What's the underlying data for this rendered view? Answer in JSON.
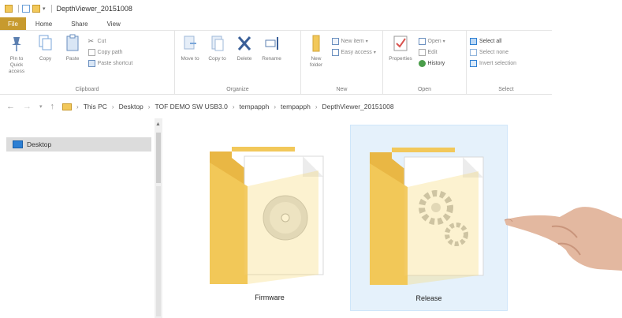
{
  "window": {
    "title": "DepthViewer_20151008"
  },
  "tabs": [
    {
      "label": "File"
    },
    {
      "label": "Home"
    },
    {
      "label": "Share"
    },
    {
      "label": "View"
    }
  ],
  "ribbon": {
    "clipboard": {
      "pin_label": "Pin to Quick access",
      "copy_label": "Copy",
      "paste_label": "Paste",
      "cut_label": "Cut",
      "copy_path_label": "Copy path",
      "paste_shortcut_label": "Paste shortcut",
      "group_label": "Clipboard"
    },
    "organize": {
      "move_to_label": "Move to",
      "copy_to_label": "Copy to",
      "delete_label": "Delete",
      "rename_label": "Rename",
      "group_label": "Organize"
    },
    "new": {
      "new_folder_label": "New folder",
      "new_item_label": "New item",
      "easy_access_label": "Easy access",
      "group_label": "New"
    },
    "open": {
      "properties_label": "Properties",
      "open_label": "Open",
      "edit_label": "Edit",
      "history_label": "History",
      "group_label": "Open"
    },
    "select": {
      "select_all_label": "Select all",
      "select_none_label": "Select none",
      "invert_selection_label": "Invert selection",
      "group_label": "Select"
    }
  },
  "address": {
    "crumbs": [
      "This PC",
      "Desktop",
      "TOF DEMO SW USB3.0",
      "tempapph",
      "tempapph",
      "DepthViewer_20151008"
    ]
  },
  "navpane": {
    "selected_item": "Desktop"
  },
  "content": {
    "items": [
      {
        "name": "Firmware",
        "type": "folder",
        "selected": false
      },
      {
        "name": "Release",
        "type": "folder",
        "selected": true
      }
    ]
  },
  "colors": {
    "file_tab": "#c79a2e",
    "folder": "#f2c85a",
    "selection": "#e5f1fb"
  }
}
